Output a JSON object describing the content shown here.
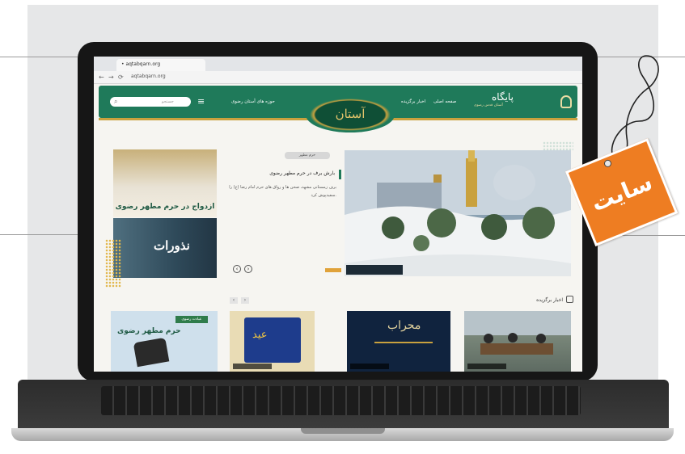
{
  "browser": {
    "tab_title": "•  aqtabqarn.org",
    "url": "aqtabqarn.org"
  },
  "site": {
    "logo": "پایگاه",
    "logo_sub": "آستان قدس رضوی",
    "nav": [
      "صفحه اصلی",
      "اخبار برگزیده",
      "حوزه های آستان رضوی"
    ],
    "search_placeholder": "جستجو",
    "medallion": "آستان"
  },
  "main": {
    "category_pill": "حرم مطهر",
    "news_title": "بارش برف در حرم مطهر رضوی",
    "news_body": "برف زمستانی مشهد، صحن ها و رواق های حرم امام رضا (ع) را سفیدپوش کرد.",
    "card1_text": "ازدواج در حرم مطهر رضوی",
    "card2_text": "نذورات",
    "section_title": "اخبار برگزیده",
    "prev": "‹",
    "next": "›"
  },
  "thumbs": {
    "t2_title": "محراب",
    "t3_text": "عید",
    "t4_badge": "عبادت رضوی",
    "t4_text": "حرم مطهر رضوی"
  },
  "tag": {
    "label": "سایت",
    "color": "#ee7d22"
  }
}
